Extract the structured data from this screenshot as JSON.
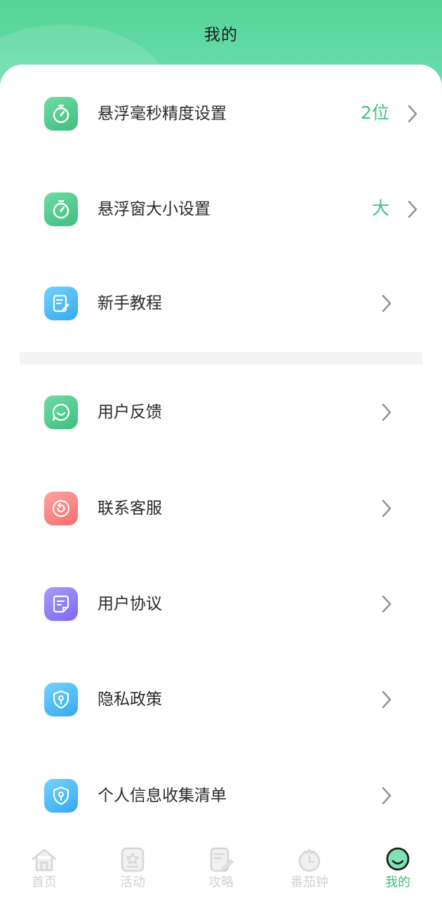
{
  "header": {
    "title": "我的"
  },
  "settings": [
    {
      "label": "悬浮毫秒精度设置",
      "value": "2位",
      "icon": "stopwatch-icon"
    },
    {
      "label": "悬浮窗大小设置",
      "value": "大",
      "icon": "stopwatch-icon"
    },
    {
      "label": "新手教程",
      "value": "",
      "icon": "edit-note-icon"
    }
  ],
  "services": [
    {
      "label": "用户反馈",
      "icon": "chat-bubble-icon"
    },
    {
      "label": "联系客服",
      "icon": "headset-icon"
    },
    {
      "label": "用户协议",
      "icon": "document-icon"
    },
    {
      "label": "隐私政策",
      "icon": "shield-key-icon"
    },
    {
      "label": "个人信息收集清单",
      "icon": "shield-key-icon"
    }
  ],
  "tabs": [
    {
      "label": "首页",
      "icon": "home-icon",
      "active": false
    },
    {
      "label": "活动",
      "icon": "star-card-icon",
      "active": false
    },
    {
      "label": "攻略",
      "icon": "guide-icon",
      "active": false
    },
    {
      "label": "番茄钟",
      "icon": "tomato-clock-icon",
      "active": false
    },
    {
      "label": "我的",
      "icon": "smile-face-icon",
      "active": true
    }
  ],
  "colors": {
    "accent": "#43c186",
    "header_green": "#55d497",
    "tab_inactive": "#d2d2d2"
  }
}
